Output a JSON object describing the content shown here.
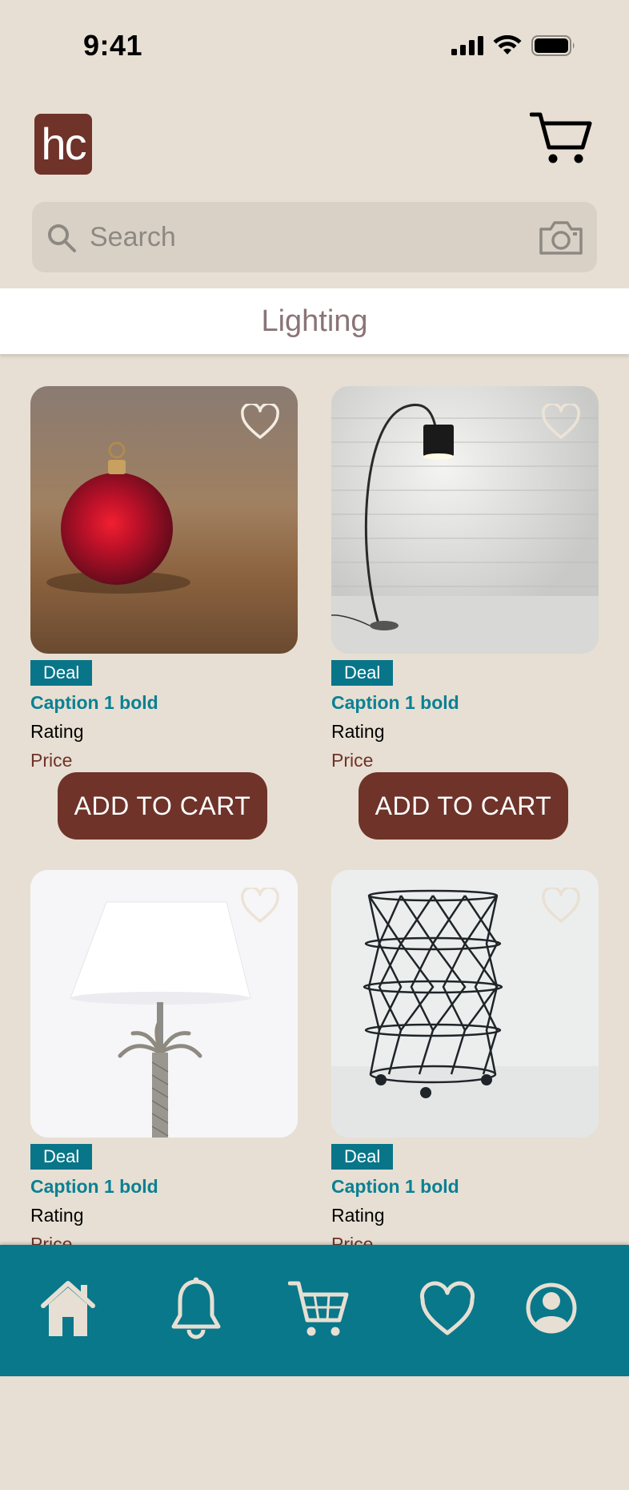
{
  "status_bar": {
    "time": "9:41"
  },
  "header": {
    "logo_text": "hc"
  },
  "search": {
    "placeholder": "Search"
  },
  "category": {
    "title": "Lighting"
  },
  "products": [
    {
      "badge": "Deal",
      "caption": "Caption 1 bold",
      "rating": "Rating",
      "price": "Price",
      "button": "ADD TO CART",
      "image": "red-ornament-photo"
    },
    {
      "badge": "Deal",
      "caption": "Caption 1 bold",
      "rating": "Rating",
      "price": "Price",
      "button": "ADD TO CART",
      "image": "arc-floor-lamp-photo"
    },
    {
      "badge": "Deal",
      "caption": "Caption 1 bold",
      "rating": "Rating",
      "price": "Price",
      "image": "palm-table-lamp-photo"
    },
    {
      "badge": "Deal",
      "caption": "Caption 1 bold",
      "rating": "Rating",
      "price": "Price",
      "image": "wire-basket-photo"
    }
  ],
  "bottom_nav": [
    "home-icon",
    "bell-icon",
    "cart-icon",
    "heart-icon",
    "profile-icon"
  ],
  "colors": {
    "background": "#e7dfd3",
    "brand_brown": "#6f3329",
    "teal": "#087589",
    "caption_teal": "#0b8093",
    "search_bg": "#d9d1c6"
  }
}
